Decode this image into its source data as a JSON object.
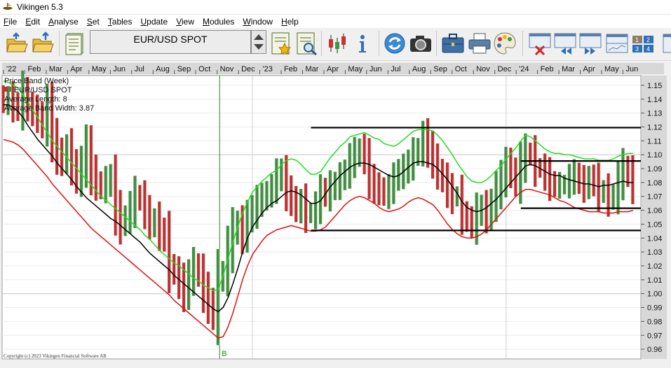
{
  "window": {
    "title": "Vikingen 5.3"
  },
  "menu": [
    {
      "label": "File",
      "ul": "F",
      "rest": "ile"
    },
    {
      "label": "Edit",
      "ul": "E",
      "rest": "dit"
    },
    {
      "label": "Analyse",
      "ul": "A",
      "rest": "nalyse"
    },
    {
      "label": "Set",
      "ul": "S",
      "rest": "et"
    },
    {
      "label": "Tables",
      "ul": "T",
      "rest": "ables"
    },
    {
      "label": "Update",
      "ul": "U",
      "rest": "pdate"
    },
    {
      "label": "View",
      "ul": "V",
      "rest": "iew"
    },
    {
      "label": "Modules",
      "ul": "M",
      "rest": "odules"
    },
    {
      "label": "Window",
      "ul": "W",
      "rest": "indow"
    },
    {
      "label": "Help",
      "ul": "H",
      "rest": "elp"
    }
  ],
  "toolbar": {
    "instrument": "EUR/USD SPOT",
    "icons": [
      "open-folder-icon",
      "upload-folder-icon",
      "notes-icon",
      "instrument-box",
      "stepper-icon",
      "favorite-list-icon",
      "search-list-icon",
      "candlestick-icon",
      "info-icon",
      "refresh-icon",
      "camera-icon",
      "briefcase-icon",
      "printer-icon",
      "palette-icon",
      "delete-chart-icon",
      "scroll-left-icon",
      "scroll-right-icon",
      "chart-window-icon",
      "layout-grid-icon",
      "window-icon"
    ]
  },
  "colors": {
    "up_bar": "#3f8f3f",
    "down_bar": "#c03030",
    "upper_band": "#22dd22",
    "lower_band": "#dd1010",
    "average": "#000000",
    "signal_line": "#228822",
    "chart_bg": "#ffffff",
    "axis_bg": "#d8d8d8"
  },
  "chart_data": {
    "type": "line",
    "series_kind": "weekly price bars with price band (upper, middle, lower)",
    "instrument": "EUR/USD SPOT",
    "legend": [
      "Price Band (Week)",
      "EUR/USD SPOT",
      "Average Length: 8",
      "Average Band Width: 3.87"
    ],
    "time_labels": [
      "'22",
      "Feb",
      "Mar",
      "Apr",
      "May",
      "Jun",
      "Jul",
      "Aug",
      "Sep",
      "Oct",
      "Nov",
      "Dec",
      "'23",
      "Feb",
      "Mar",
      "Apr",
      "May",
      "Jun",
      "Jul",
      "Aug",
      "Sep",
      "Oct",
      "Nov",
      "Dec",
      "'24",
      "Feb",
      "Mar",
      "Apr",
      "May",
      "Jun"
    ],
    "y_ticks": [
      0.96,
      0.97,
      0.98,
      0.99,
      1.0,
      1.01,
      1.02,
      1.03,
      1.04,
      1.05,
      1.06,
      1.07,
      1.08,
      1.09,
      1.1,
      1.11,
      1.12,
      1.13,
      1.14,
      1.15
    ],
    "ylim": [
      0.953,
      1.157
    ],
    "weeks": 130,
    "signal_label": "B",
    "signal_week": 44,
    "year_separator_weeks": [
      51,
      103
    ],
    "close": [
      1.138,
      1.14,
      1.136,
      1.133,
      1.145,
      1.135,
      1.131,
      1.128,
      1.122,
      1.135,
      1.112,
      1.1,
      1.097,
      1.104,
      1.093,
      1.083,
      1.093,
      1.105,
      1.087,
      1.08,
      1.076,
      1.081,
      1.082,
      1.06,
      1.05,
      1.055,
      1.062,
      1.07,
      1.068,
      1.06,
      1.05,
      1.052,
      1.045,
      1.04,
      1.02,
      1.015,
      1.008,
      1.001,
      1.012,
      1.02,
      1.014,
      1.001,
      0.993,
      0.985,
      1.01,
      1.015,
      1.032,
      1.045,
      1.05,
      1.042,
      1.055,
      1.06,
      1.065,
      1.07,
      1.071,
      1.077,
      1.085,
      1.086,
      1.073,
      1.068,
      1.061,
      1.065,
      1.058,
      1.058,
      1.062,
      1.074,
      1.072,
      1.076,
      1.079,
      1.083,
      1.088,
      1.096,
      1.1,
      1.103,
      1.098,
      1.082,
      1.076,
      1.075,
      1.072,
      1.075,
      1.084,
      1.087,
      1.089,
      1.094,
      1.1,
      1.104,
      1.112,
      1.105,
      1.095,
      1.088,
      1.082,
      1.074,
      1.07,
      1.07,
      1.058,
      1.053,
      1.05,
      1.058,
      1.062,
      1.056,
      1.065,
      1.075,
      1.082,
      1.093,
      1.088,
      1.08,
      1.094,
      1.101,
      1.1,
      1.091,
      1.09,
      1.085,
      1.08,
      1.078,
      1.078,
      1.079,
      1.083,
      1.085,
      1.081,
      1.077,
      1.083,
      1.08,
      1.073,
      1.074,
      1.068,
      1.071,
      1.082,
      1.09,
      1.086,
      1.078
    ],
    "upper_band": [
      1.153,
      1.152,
      1.15,
      1.148,
      1.143,
      1.138,
      1.132,
      1.127,
      1.121,
      1.116,
      1.11,
      1.106,
      1.102,
      1.098,
      1.094,
      1.09,
      1.086,
      1.082,
      1.078,
      1.074,
      1.07,
      1.067,
      1.064,
      1.061,
      1.058,
      1.055,
      1.052,
      1.049,
      1.046,
      1.042,
      1.039,
      1.035,
      1.031,
      1.028,
      1.025,
      1.022,
      1.02,
      1.017,
      1.014,
      1.011,
      1.009,
      1.006,
      1.004,
      1.002,
      1.003,
      1.013,
      1.025,
      1.037,
      1.048,
      1.058,
      1.066,
      1.073,
      1.077,
      1.081,
      1.084,
      1.087,
      1.089,
      1.093,
      1.096,
      1.097,
      1.096,
      1.093,
      1.089,
      1.086,
      1.086,
      1.088,
      1.093,
      1.098,
      1.102,
      1.106,
      1.109,
      1.113,
      1.114,
      1.115,
      1.116,
      1.114,
      1.112,
      1.111,
      1.108,
      1.107,
      1.106,
      1.108,
      1.111,
      1.114,
      1.117,
      1.118,
      1.118,
      1.118,
      1.117,
      1.114,
      1.11,
      1.105,
      1.1,
      1.094,
      1.089,
      1.084,
      1.081,
      1.08,
      1.08,
      1.082,
      1.085,
      1.089,
      1.092,
      1.097,
      1.101,
      1.105,
      1.11,
      1.114,
      1.113,
      1.11,
      1.107,
      1.104,
      1.102,
      1.101,
      1.101,
      1.1,
      1.1,
      1.099,
      1.098,
      1.097,
      1.097,
      1.097,
      1.096,
      1.096,
      1.096,
      1.097,
      1.099,
      1.1,
      1.101,
      1.101
    ],
    "middle_average": [
      1.136,
      1.136,
      1.134,
      1.131,
      1.127,
      1.121,
      1.116,
      1.111,
      1.107,
      1.103,
      1.099,
      1.094,
      1.09,
      1.086,
      1.082,
      1.077,
      1.073,
      1.069,
      1.066,
      1.063,
      1.06,
      1.057,
      1.054,
      1.052,
      1.049,
      1.046,
      1.043,
      1.04,
      1.037,
      1.033,
      1.029,
      1.026,
      1.023,
      1.02,
      1.017,
      1.013,
      1.01,
      1.007,
      1.004,
      1.001,
      0.998,
      0.995,
      0.992,
      0.989,
      0.987,
      0.99,
      0.997,
      1.007,
      1.018,
      1.03,
      1.04,
      1.048,
      1.053,
      1.058,
      1.062,
      1.065,
      1.067,
      1.07,
      1.073,
      1.074,
      1.073,
      1.071,
      1.068,
      1.065,
      1.065,
      1.067,
      1.072,
      1.077,
      1.081,
      1.085,
      1.088,
      1.091,
      1.093,
      1.094,
      1.094,
      1.093,
      1.091,
      1.089,
      1.087,
      1.085,
      1.084,
      1.085,
      1.088,
      1.091,
      1.094,
      1.095,
      1.095,
      1.094,
      1.093,
      1.09,
      1.086,
      1.082,
      1.077,
      1.072,
      1.066,
      1.062,
      1.06,
      1.059,
      1.06,
      1.062,
      1.065,
      1.068,
      1.072,
      1.076,
      1.08,
      1.084,
      1.088,
      1.092,
      1.093,
      1.092,
      1.09,
      1.088,
      1.086,
      1.085,
      1.085,
      1.083,
      1.082,
      1.081,
      1.08,
      1.079,
      1.079,
      1.078,
      1.077,
      1.078,
      1.078,
      1.079,
      1.08,
      1.081,
      1.08,
      1.08
    ],
    "lower_band": [
      1.111,
      1.11,
      1.109,
      1.107,
      1.104,
      1.1,
      1.096,
      1.092,
      1.088,
      1.084,
      1.079,
      1.075,
      1.071,
      1.067,
      1.063,
      1.059,
      1.055,
      1.051,
      1.047,
      1.044,
      1.041,
      1.038,
      1.035,
      1.032,
      1.029,
      1.026,
      1.023,
      1.02,
      1.017,
      1.014,
      1.011,
      1.008,
      1.005,
      1.002,
      0.999,
      0.995,
      0.992,
      0.989,
      0.986,
      0.983,
      0.98,
      0.977,
      0.974,
      0.971,
      0.968,
      0.969,
      0.976,
      0.986,
      0.998,
      1.01,
      1.02,
      1.028,
      1.033,
      1.038,
      1.042,
      1.044,
      1.046,
      1.047,
      1.048,
      1.049,
      1.048,
      1.047,
      1.046,
      1.045,
      1.045,
      1.046,
      1.048,
      1.052,
      1.056,
      1.06,
      1.064,
      1.067,
      1.069,
      1.07,
      1.069,
      1.067,
      1.065,
      1.062,
      1.06,
      1.059,
      1.06,
      1.061,
      1.063,
      1.066,
      1.068,
      1.069,
      1.068,
      1.066,
      1.064,
      1.06,
      1.055,
      1.05,
      1.046,
      1.043,
      1.041,
      1.04,
      1.04,
      1.041,
      1.043,
      1.046,
      1.05,
      1.054,
      1.058,
      1.062,
      1.066,
      1.07,
      1.073,
      1.075,
      1.075,
      1.074,
      1.073,
      1.072,
      1.071,
      1.069,
      1.067,
      1.066,
      1.064,
      1.062,
      1.061,
      1.06,
      1.059,
      1.059,
      1.059,
      1.058,
      1.058,
      1.058,
      1.059,
      1.059,
      1.059,
      1.06
    ],
    "support_resistance": [
      {
        "from_week": 63,
        "to_week": 131,
        "value": 1.1195
      },
      {
        "from_week": 63,
        "to_week": 131,
        "value": 1.0455
      },
      {
        "from_week": 106,
        "to_week": 131,
        "value": 1.0955
      },
      {
        "from_week": 106,
        "to_week": 131,
        "value": 1.0615
      }
    ],
    "grid": true,
    "copyright": "Copyright (c) 2023 Vikingen Financial Software AB"
  }
}
